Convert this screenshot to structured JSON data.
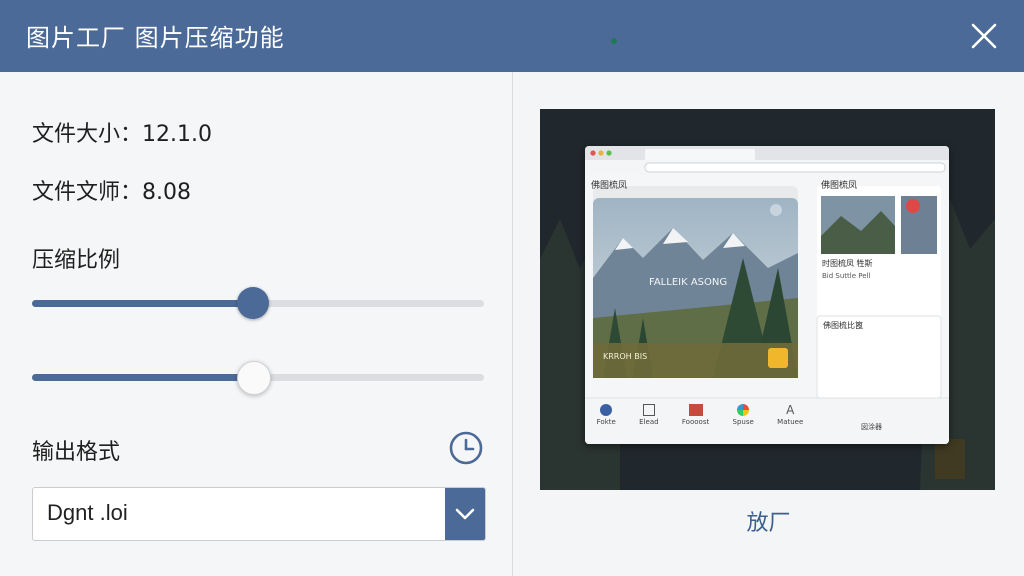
{
  "titlebar": {
    "title": "图片工厂  图片压缩功能"
  },
  "info": {
    "file_size_label": "文件大小：",
    "file_size_value": "12.1.0",
    "file_other_label": "文件文师：",
    "file_other_value": "8.08"
  },
  "compression": {
    "label": "压缩比例",
    "slider1": 0.49,
    "slider2": 0.49
  },
  "output": {
    "label": "输出格式",
    "format_value": "Dgnt .loi"
  },
  "preview": {
    "zoom_label": "放厂",
    "browser": {
      "section_left": "佛图梳凤",
      "banner_text": "FALLEIK ASONG",
      "banner_bottom_left": "KRROH BIS",
      "section_right": "佛图梳凤",
      "card_title": "时图梳凤 牲斯",
      "card_sub": "Bid Suttle Pell",
      "panel_title": "佛图梳比篦",
      "dock": [
        "Fokte",
        "Elead",
        "Foooost",
        "Spuse",
        "Matuee"
      ],
      "dock_right": "図涂器"
    }
  },
  "colors": {
    "accent": "#4b6a97",
    "titlebar": "#4b6a97",
    "link": "#3d5f8f"
  },
  "icons": {
    "close": "close-icon",
    "history": "history-icon",
    "dropdown": "chevron-down-icon"
  }
}
